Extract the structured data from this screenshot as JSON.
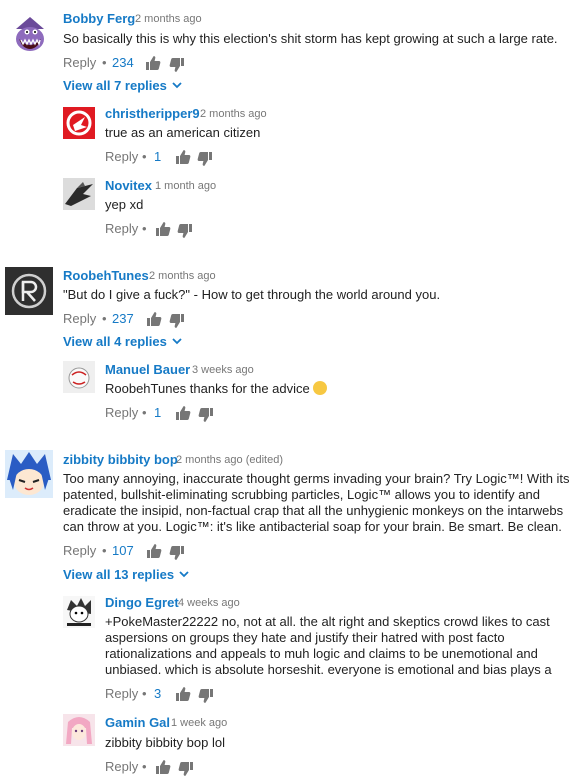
{
  "threads": [
    {
      "author": "Bobby Ferg",
      "time": "2 months ago",
      "text": "So basically this is why this election's shit storm has kept growing at such a large rate.",
      "reply_label": "Reply",
      "likes": "234",
      "view_all": "View all 7 replies",
      "avatar_icon": "monster-avatar-icon",
      "replies": [
        {
          "author": "christheripper9",
          "time": "2 months ago",
          "text": "true as an american citizen",
          "reply_label": "Reply",
          "likes": "1",
          "avatar_icon": "hawks-logo-avatar-icon"
        },
        {
          "author": "Novitex",
          "time": "1 month ago",
          "text": "yep xd",
          "reply_label": "Reply",
          "likes": "",
          "avatar_icon": "bird-avatar-icon"
        }
      ]
    },
    {
      "author": "RoobehTunes",
      "time": "2 months ago",
      "text": "\"But do I give a fuck?\" - How to get through the world around you.",
      "reply_label": "Reply",
      "likes": "237",
      "view_all": "View all 4 replies",
      "avatar_icon": "r-logo-avatar-icon",
      "replies": [
        {
          "author": "Manuel Bauer",
          "time": "3 weeks ago",
          "text": "RoobehTunes thanks for the advice",
          "emoji": "😊",
          "reply_label": "Reply",
          "likes": "1",
          "avatar_icon": "ball-avatar-icon"
        }
      ]
    },
    {
      "author": "zibbity bibbity bop",
      "time": "2 months ago (edited)",
      "text_lines": [
        "Too many annoying, inaccurate thought germs invading your brain?  Try Logic™!  With its",
        "patented, bullshit-eliminating scrubbing particles, Logic™ allows you to identify and",
        "eradicate the insipid, non-factual crap that all the unhygienic monkeys on the intarwebs",
        "can throw at you.  Logic™: it's like antibacterial soap for your brain.  Be smart.  Be clean."
      ],
      "reply_label": "Reply",
      "likes": "107",
      "view_all": "View all 13 replies",
      "avatar_icon": "anime-avatar-icon",
      "replies": [
        {
          "author": "Dingo Egret",
          "time": "4 weeks ago",
          "text_lines": [
            "+PokeMaster22222 no, not at all. the alt right and skeptics crowd likes to cast",
            "aspersions on groups they hate and justify their hatred with post facto",
            "rationalizations and appeals to muh logic and claims to be unemotional and",
            "unbiased. which is absolute horseshit. everyone is emotional and bias plays a"
          ],
          "reply_label": "Reply",
          "likes": "3",
          "avatar_icon": "manga-avatar-icon"
        },
        {
          "author": "Gamin Gal",
          "time": "1 week ago",
          "text": "zibbity bibbity bop lol",
          "reply_label": "Reply",
          "likes": "",
          "avatar_icon": "pink-hair-avatar-icon"
        }
      ]
    }
  ],
  "colors": {
    "link": "#167ac6",
    "meta": "#777777",
    "text": "#222222",
    "icon": "#767676"
  },
  "separator": "•"
}
